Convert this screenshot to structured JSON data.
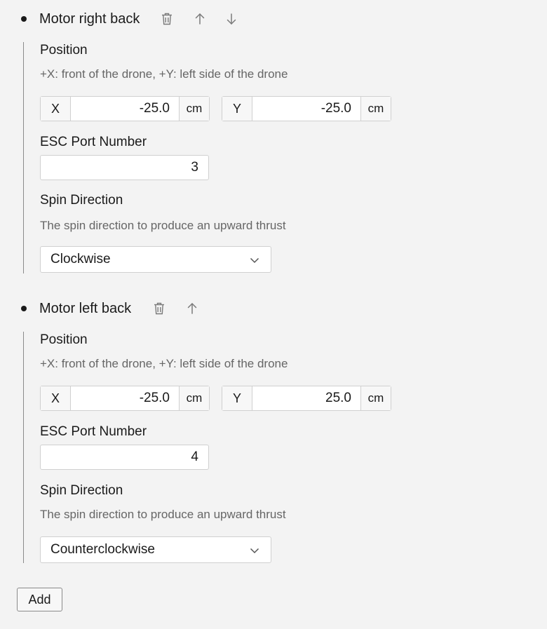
{
  "motors": [
    {
      "title": "Motor right back",
      "position_label": "Position",
      "position_desc": "+X: front of the drone, +Y: left side of the drone",
      "x_axis": "X",
      "x_value": "-25.0",
      "x_unit": "cm",
      "y_axis": "Y",
      "y_value": "-25.0",
      "y_unit": "cm",
      "esc_label": "ESC Port Number",
      "esc_value": "3",
      "spin_label": "Spin Direction",
      "spin_desc": "The spin direction to produce an upward thrust",
      "spin_value": "Clockwise",
      "icons": [
        "trash-icon",
        "arrow-up-icon",
        "arrow-down-icon"
      ]
    },
    {
      "title": "Motor left back",
      "position_label": "Position",
      "position_desc": "+X: front of the drone, +Y: left side of the drone",
      "x_axis": "X",
      "x_value": "-25.0",
      "x_unit": "cm",
      "y_axis": "Y",
      "y_value": "25.0",
      "y_unit": "cm",
      "esc_label": "ESC Port Number",
      "esc_value": "4",
      "spin_label": "Spin Direction",
      "spin_desc": "The spin direction to produce an upward thrust",
      "spin_value": "Counterclockwise",
      "icons": [
        "trash-icon",
        "arrow-up-icon"
      ]
    }
  ],
  "add_label": "Add",
  "colors": {
    "background": "#f3f3f3",
    "field": "#ffffff",
    "border": "#d0d0d0",
    "icon": "#7a7a7a"
  }
}
